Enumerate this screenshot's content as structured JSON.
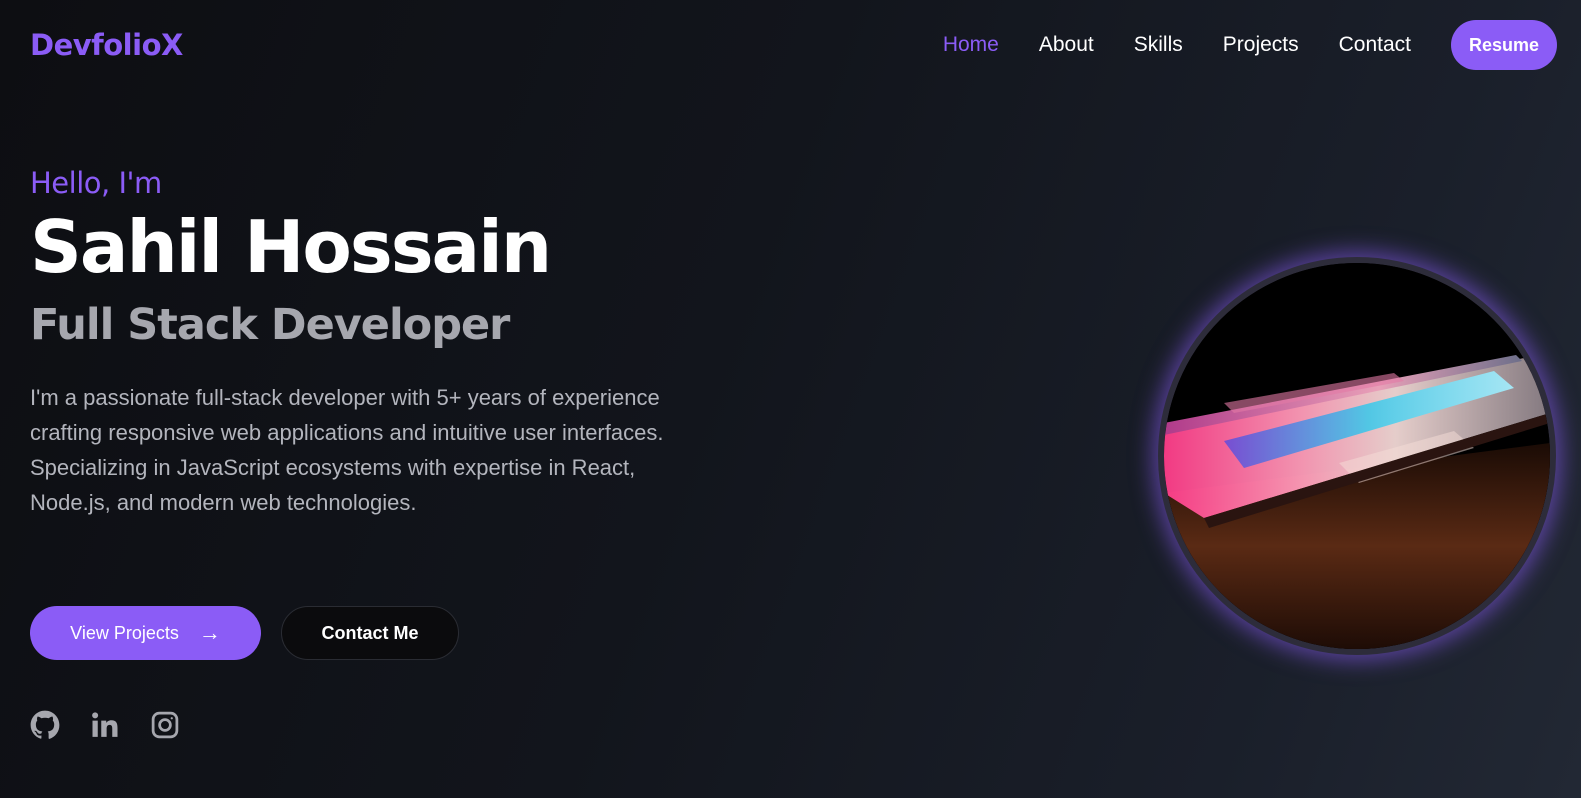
{
  "nav": {
    "brand": "DevfolioX",
    "links": [
      {
        "label": "Home",
        "active": true
      },
      {
        "label": "About",
        "active": false
      },
      {
        "label": "Skills",
        "active": false
      },
      {
        "label": "Projects",
        "active": false
      },
      {
        "label": "Contact",
        "active": false
      }
    ],
    "resume_label": "Resume"
  },
  "hero": {
    "greeting": "Hello, I'm",
    "name": "Sahil Hossain",
    "role": "Full Stack Developer",
    "bio": "I'm a passionate full-stack developer with 5+ years of experience crafting responsive web applications and intuitive user interfaces. Specializing in JavaScript ecosystems with expertise in React, Node.js, and modern web technologies."
  },
  "actions": {
    "primary_label": "View Projects",
    "primary_arrow": "→",
    "secondary_label": "Contact Me"
  },
  "social": [
    "github-icon",
    "linkedin-icon",
    "instagram-icon"
  ],
  "colors": {
    "accent": "#8b5cf6",
    "text": "#ffffff",
    "muted": "#a6a7ae"
  }
}
